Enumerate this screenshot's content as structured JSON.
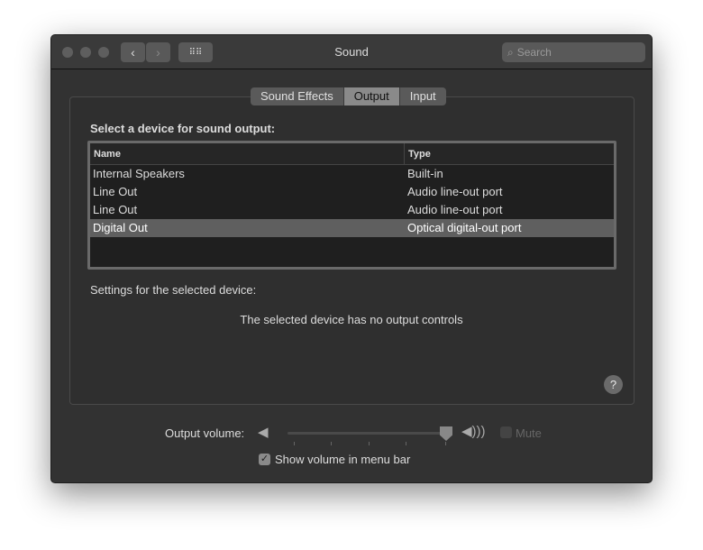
{
  "window": {
    "title": "Sound",
    "search_placeholder": "Search"
  },
  "tabs": [
    {
      "label": "Sound Effects"
    },
    {
      "label": "Output",
      "selected": true
    },
    {
      "label": "Input"
    }
  ],
  "output": {
    "heading": "Select a device for sound output:",
    "columns": [
      "Name",
      "Type"
    ],
    "devices": [
      {
        "name": "Internal Speakers",
        "type": "Built-in"
      },
      {
        "name": "Line Out",
        "type": "Audio line-out port"
      },
      {
        "name": "Line Out",
        "type": "Audio line-out port"
      },
      {
        "name": "Digital Out",
        "type": "Optical digital-out port",
        "selected": true
      }
    ],
    "settings_label": "Settings for the selected device:",
    "no_controls": "The selected device has no output controls"
  },
  "volume": {
    "label": "Output volume:",
    "level": 1.0,
    "mute_label": "Mute",
    "mute_checked": false,
    "mute_enabled": false,
    "show_in_menu_label": "Show volume in menu bar",
    "show_in_menu_checked": true
  },
  "help": "?"
}
